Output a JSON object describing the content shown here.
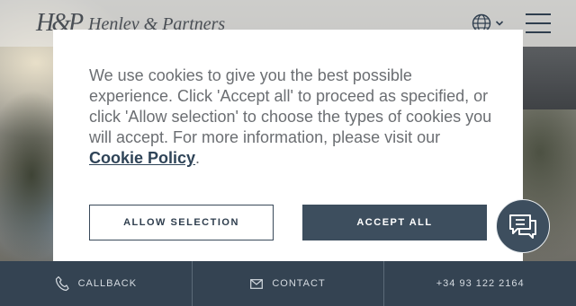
{
  "header": {
    "logo_mark": "H&P",
    "logo_text": "Henley & Partners",
    "language_icon": "globe-icon",
    "menu_icon": "hamburger-menu-icon"
  },
  "cookie_dialog": {
    "message_before_link": "We use cookies to give you the best possible experience. Click 'Accept all' to proceed as specified, or click 'Allow selection' to choose the types of cookies you will accept. For more information, please visit our ",
    "link_text": "Cookie Policy",
    "message_after_link": ".",
    "allow_selection_label": "ALLOW SELECTION",
    "accept_all_label": "ACCEPT ALL"
  },
  "chat_button": {
    "icon": "chat-bubbles-icon"
  },
  "footer": {
    "callback_label": "CALLBACK",
    "callback_icon": "phone-icon",
    "contact_label": "CONTACT",
    "contact_icon": "envelope-icon",
    "phone_number": "+34 93 122 2164"
  },
  "colors": {
    "primary": "#3d4e5e",
    "footer_bg": "#344352",
    "text_gray": "#6b6e72",
    "link": "#2f4458"
  }
}
